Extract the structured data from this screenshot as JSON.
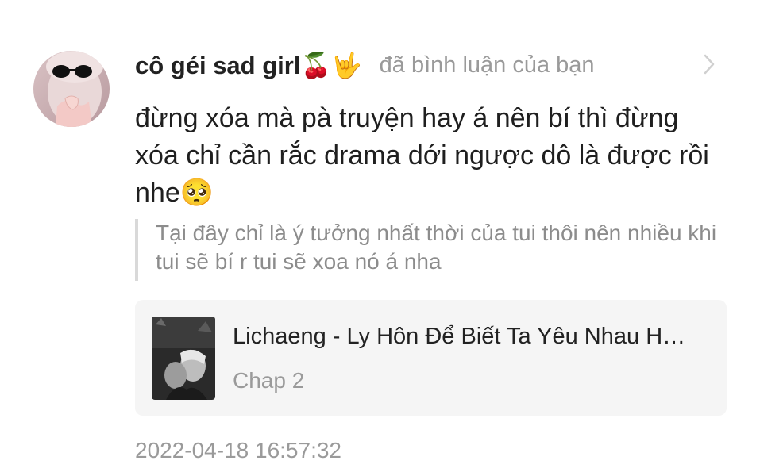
{
  "comment_item": {
    "username": "cô géi sad girl🍒🤟",
    "action_text": "đã bình luận của bạn",
    "comment_text": "đừng xóa mà pà truyện hay á nên bí thì đừng xóa chỉ cần rắc drama dới ngược dô là được rồi nhe🥺",
    "quoted_text": "Tại đây chỉ là ý tưởng nhất thời của tui thôi nên nhiều khi tui sẽ bí r tui sẽ xoa nó á nha",
    "story": {
      "title": "Lichaeng - Ly Hôn Để Biết Ta Yêu Nhau H…",
      "chapter": "Chap 2"
    },
    "timestamp": "2022-04-18 16:57:32"
  },
  "icons": {
    "avatar": "avatar-girl-sunglasses",
    "chevron": "chevron-right-icon",
    "cover": "story-cover-image"
  },
  "colors": {
    "text_primary": "#222222",
    "text_secondary": "#9a9a9a",
    "card_bg": "#f5f5f5",
    "quote_bar": "#d9d9d9"
  }
}
